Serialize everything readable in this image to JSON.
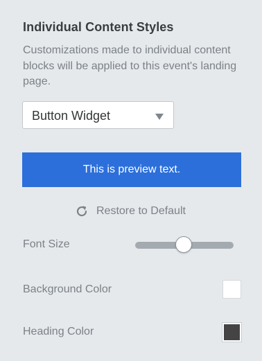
{
  "section": {
    "title": "Individual Content Styles",
    "description": "Customizations made to individual content blocks will be applied to this event's landing page."
  },
  "widget_select": {
    "selected": "Button Widget",
    "caret_icon": "caret-down-icon"
  },
  "preview": {
    "text": "This is preview text.",
    "color": "#2c6fdb"
  },
  "restore": {
    "label": "Restore to Default",
    "icon": "refresh-icon"
  },
  "settings": {
    "font_size": {
      "label": "Font Size",
      "slider_value_fraction": 0.49
    },
    "background_color": {
      "label": "Background Color",
      "value": "#ffffff"
    },
    "heading_color": {
      "label": "Heading Color",
      "value": "#444444"
    }
  }
}
